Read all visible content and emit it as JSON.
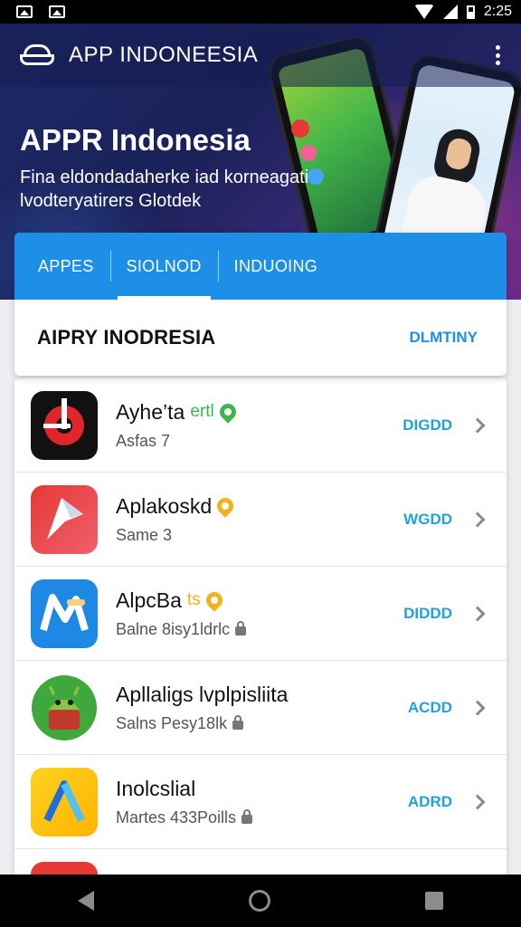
{
  "status_bar": {
    "time": "2:25"
  },
  "header": {
    "app_title": "APP INDONEESIA",
    "hero_title": "APPR Indonesia",
    "hero_subtitle": "Fina eldondadaherke iad korneagati lvodteryatirers Glotdek"
  },
  "tabs": [
    {
      "label": "APPES",
      "active": false
    },
    {
      "label": "SIOLNOD",
      "active": true
    },
    {
      "label": "INDUOING",
      "active": false
    }
  ],
  "section": {
    "title": "AIPRY INODRESIA",
    "action": "DLMTINY"
  },
  "apps": [
    {
      "name": "Ayhe’ta",
      "name_tag": "ertl",
      "sub": "Asfas 7",
      "action": "DIGDD",
      "badge_color": "#3cb54a",
      "icon": "red-black-app-icon"
    },
    {
      "name": "Aplakoskd",
      "name_tag": "",
      "sub": "Same 3",
      "action": "WGDD",
      "badge_color": "#f2b21c",
      "icon": "red-arrow-app-icon"
    },
    {
      "name": "AlpcBa",
      "name_tag": "ts",
      "sub": "Balne 8isy1ldrlc",
      "action": "DIDDD",
      "badge_color": "#f2b21c",
      "icon": "blue-m-app-icon"
    },
    {
      "name": "Apllaligs lvplpisliita",
      "name_tag": "",
      "sub": "Salns Pesy18lk",
      "action": "ACDD",
      "badge_color": "",
      "icon": "android-app-icon"
    },
    {
      "name": "Inolcslial",
      "name_tag": "",
      "sub": "Martes 433Poills",
      "action": "ADRD",
      "badge_color": "",
      "icon": "yellow-a-app-icon"
    }
  ],
  "colors": {
    "primary": "#1e8fe6",
    "action": "#22a2d8",
    "hero": "#1d2a66"
  }
}
